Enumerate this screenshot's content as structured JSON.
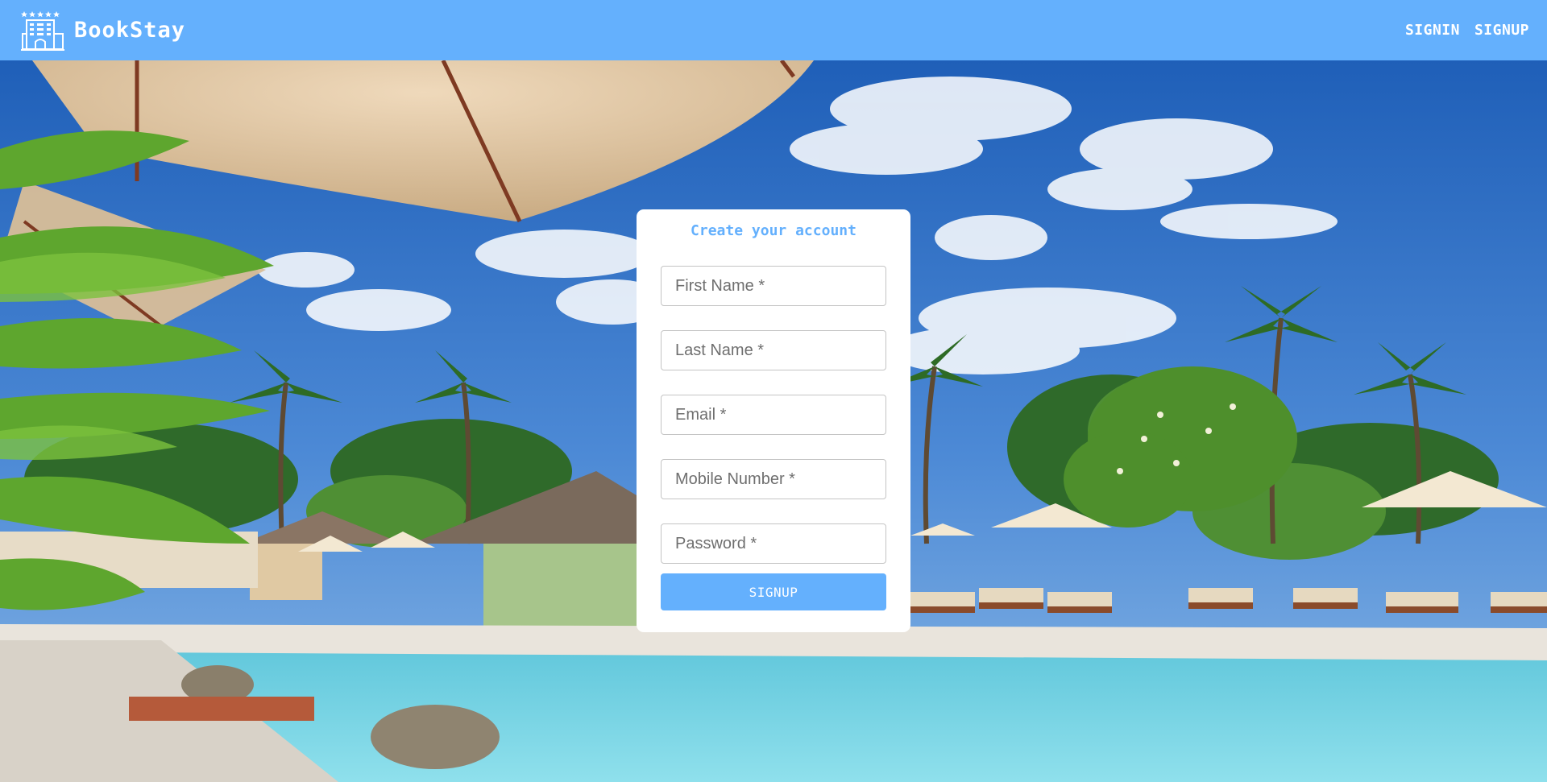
{
  "brand": {
    "name": "BookStay",
    "icon": "hotel-icon"
  },
  "nav": {
    "signin_label": "SIGNIN",
    "signup_label": "SIGNUP"
  },
  "form": {
    "title": "Create your account",
    "fields": {
      "first_name": {
        "placeholder": "First Name *",
        "value": ""
      },
      "last_name": {
        "placeholder": "Last Name *",
        "value": ""
      },
      "email": {
        "placeholder": "Email *",
        "value": ""
      },
      "mobile": {
        "placeholder": "Mobile Number *",
        "value": ""
      },
      "password": {
        "placeholder": "Password *",
        "value": ""
      }
    },
    "submit_label": "SIGNUP"
  },
  "colors": {
    "accent": "#64b0fd",
    "card": "#ffffff",
    "sky": "#2e6fc2",
    "pool": "#6fd0e4"
  }
}
